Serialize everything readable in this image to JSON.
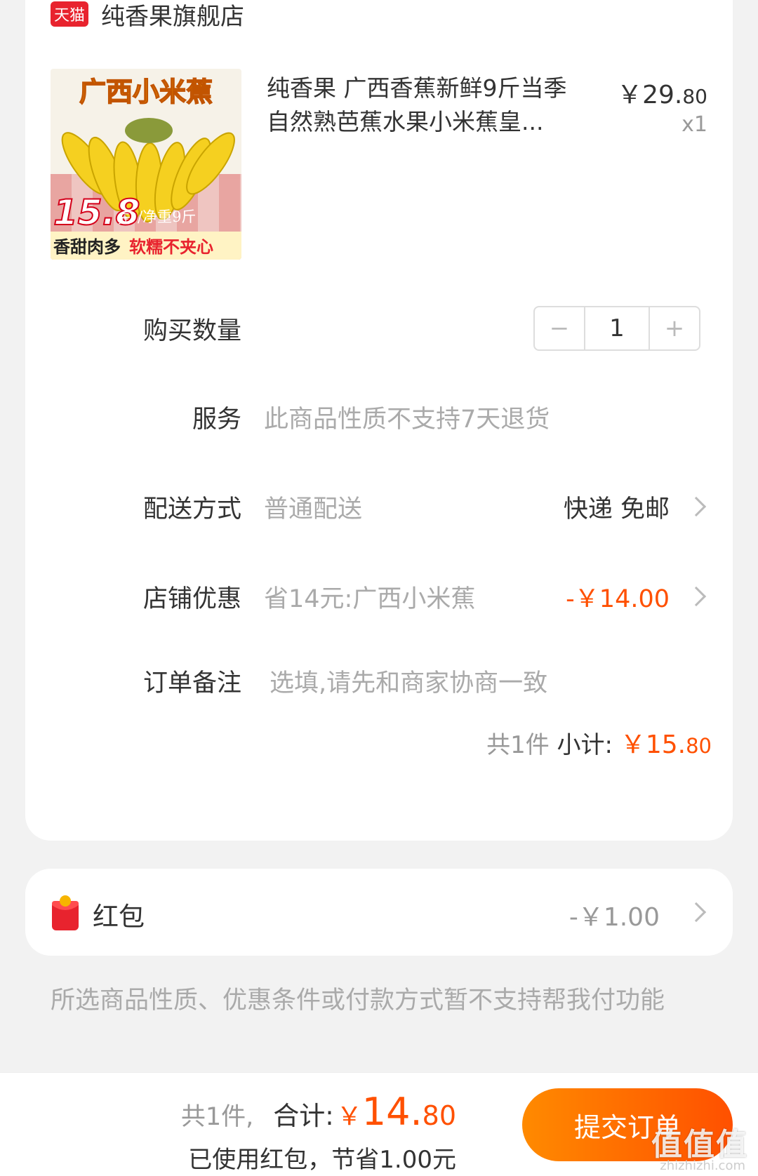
{
  "store": {
    "badge": "天猫",
    "name": "纯香果旗舰店"
  },
  "product": {
    "title": "纯香果 广西香蕉新鲜9斤当季自然熟芭蕉水果小米蕉皇...",
    "price_main": "￥29.",
    "price_cents": "80",
    "quantity_text": "x1",
    "image_text": {
      "headline": "广西小米蕉",
      "price_big": "15.8",
      "price_unit": "元",
      "weight": "/净重9斤",
      "slogan_a": "香甜肉多",
      "slogan_b": "软糯不夹心"
    }
  },
  "quantity_row": {
    "label": "购买数量",
    "minus": "−",
    "value": "1",
    "plus": "+"
  },
  "service_row": {
    "label": "服务",
    "value": "此商品性质不支持7天退货"
  },
  "delivery_row": {
    "label": "配送方式",
    "value": "普通配送",
    "right": "快递 免邮"
  },
  "discount_row": {
    "label": "店铺优惠",
    "value": "省14元:广西小米蕉",
    "right": "-￥14.00"
  },
  "remark_row": {
    "label": "订单备注",
    "placeholder": "选填,请先和商家协商一致"
  },
  "subtotal": {
    "count": "共1件",
    "label": "小计:",
    "amount_main": "￥15.",
    "amount_cents": "80"
  },
  "red_packet": {
    "label": "红包",
    "value": "-￥1.00"
  },
  "notice": "所选商品性质、优惠条件或付款方式暂不支持帮我付功能",
  "footer": {
    "count": "共1件,",
    "total_label": "合计:",
    "total_yen": "￥",
    "total_main": "14.",
    "total_cents": "80",
    "saved": "已使用红包，节省1.00元",
    "submit": "提交订单"
  },
  "watermark": {
    "main": "值值值",
    "sub": "zhizhizhi.com"
  },
  "colors": {
    "accent": "#ff5000",
    "tmall_red": "#e8232e",
    "muted": "#aaaaaa",
    "page_bg": "#f2f2f2"
  },
  "icons": [
    "tmall-badge-icon",
    "chevron-right-icon",
    "red-packet-icon"
  ]
}
